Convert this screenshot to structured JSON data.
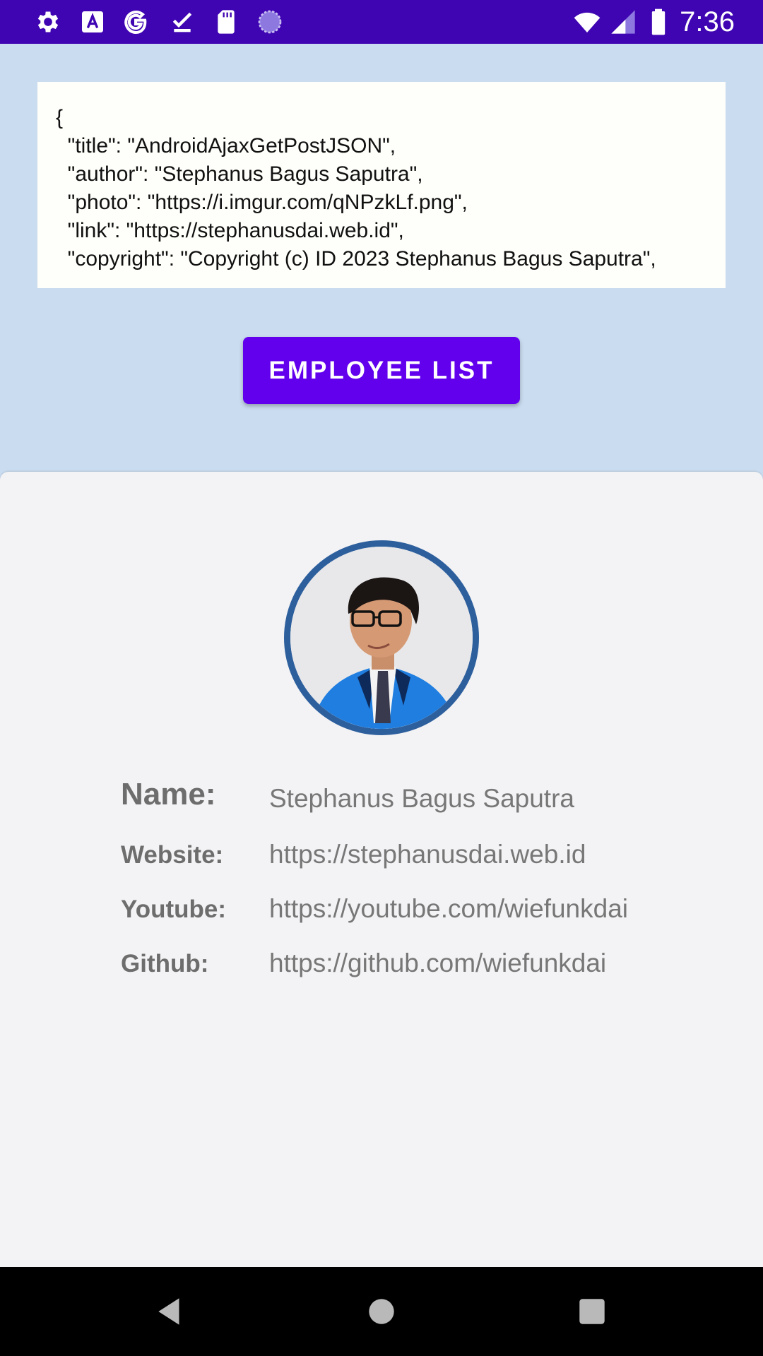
{
  "status_bar": {
    "time": "7:36",
    "left_icons": [
      "settings-icon",
      "font-a-icon",
      "google-g-icon",
      "download-done-icon",
      "sd-card-icon",
      "loading-circle-icon"
    ],
    "right_icons": [
      "wifi-icon",
      "cell-signal-icon",
      "battery-icon"
    ]
  },
  "json_box": {
    "text": "{\n  \"title\": \"AndroidAjaxGetPostJSON\",\n  \"author\": \"Stephanus Bagus Saputra\",\n  \"photo\": \"https://i.imgur.com/qNPzkLf.png\",\n  \"link\": \"https://stephanusdai.web.id\",\n  \"copyright\": \"Copyright (c) ID 2023 Stephanus Bagus Saputra\",\n  ..."
  },
  "button": {
    "label": "EMPLOYEE LIST"
  },
  "profile": {
    "avatar": "profile-photo",
    "rows": [
      {
        "label": "Name:",
        "value": "Stephanus Bagus Saputra"
      },
      {
        "label": "Website:",
        "value": "https://stephanusdai.web.id"
      },
      {
        "label": "Youtube:",
        "value": "https://youtube.com/wiefunkdai"
      },
      {
        "label": "Github:",
        "value": "https://github.com/wiefunkdai"
      }
    ]
  },
  "nav_bar": {
    "buttons": [
      "back-icon",
      "home-icon",
      "recents-icon"
    ]
  },
  "colors": {
    "status_bar": "#3f05b2",
    "background": "#cadcf0",
    "button": "#6200ee",
    "card": "#f3f3f5",
    "avatar_ring": "#2d5f9d"
  }
}
